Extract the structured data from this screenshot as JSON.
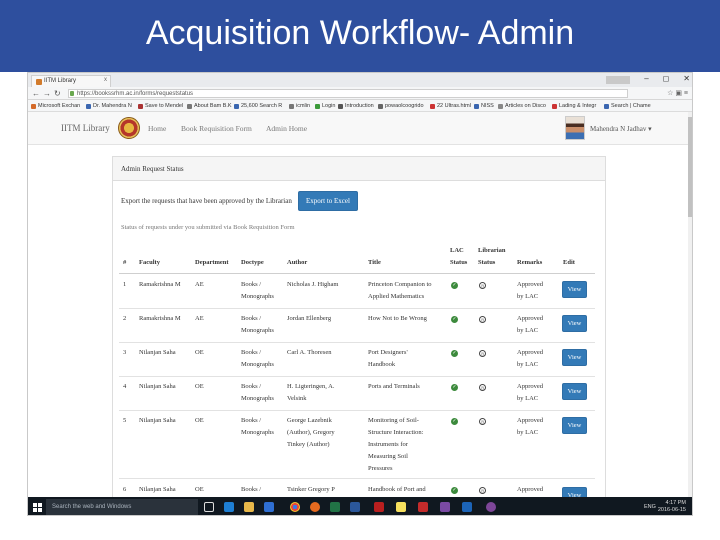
{
  "slide": {
    "title": "Acquisition Workflow- Admin"
  },
  "browser": {
    "tab_label": "IITM Library",
    "tab_close": "x",
    "url": "https://bookssrhm.ac.in/forms/requeststatus",
    "window_controls": [
      "–",
      "◻",
      "✕"
    ],
    "bookmarks": [
      {
        "label": "Microsoft Exchan",
        "color": "#d46a2a"
      },
      {
        "label": "Dr. Mahendra N",
        "color": "#3a66b0"
      },
      {
        "label": "Save to Mendel",
        "color": "#a33"
      },
      {
        "label": "About Bam B.K",
        "color": "#777"
      },
      {
        "label": "25,600 Search R",
        "color": "#3a66b0"
      },
      {
        "label": "icmlin",
        "color": "#777"
      },
      {
        "label": "Login",
        "color": "#3a9a3a"
      },
      {
        "label": "Introduction",
        "color": "#555"
      },
      {
        "label": "powaolcoogrido",
        "color": "#666"
      },
      {
        "label": "22 Ultras.html",
        "color": "#c33"
      },
      {
        "label": "NISS",
        "color": "#3a66b0"
      },
      {
        "label": "Articles on Disco",
        "color": "#888"
      },
      {
        "label": "Lading & Integr",
        "color": "#c33"
      },
      {
        "label": "Search | Chame",
        "color": "#3a66b0"
      }
    ]
  },
  "app_nav": {
    "brand": "IITM Library",
    "links": [
      "Home",
      "Book Requisition Form",
      "Admin Home"
    ],
    "user_name": "Mahendra N Jadhav ▾"
  },
  "panel": {
    "title": "Admin Request Status",
    "export_text": "Export the requests that have been approved by the Librarian",
    "export_button": "Export to Excel",
    "status_note": "Status of requests under you submitted via Book Requisition Form"
  },
  "table": {
    "headers": {
      "num": "#",
      "faculty": "Faculty",
      "department": "Department",
      "doctype": "Doctype",
      "author": "Author",
      "title": "Title",
      "lac_status_1": "LAC",
      "lac_status_2": "Status",
      "librarian_status_1": "Librarian",
      "librarian_status_2": "Status",
      "remarks": "Remarks",
      "edit": "Edit"
    },
    "rows": [
      {
        "num": "1",
        "faculty": "Ramakrishna M",
        "department": "AE",
        "doctype": [
          "Books /",
          "Monographs"
        ],
        "author": [
          "Nicholas J. Higham"
        ],
        "title": [
          "Princeton Companion to",
          "Applied Mathematics"
        ],
        "remarks": [
          "Approved",
          "by LAC"
        ],
        "view": "View"
      },
      {
        "num": "2",
        "faculty": "Ramakrishna M",
        "department": "AE",
        "doctype": [
          "Books /",
          "Monographs"
        ],
        "author": [
          "Jordan Ellenberg"
        ],
        "title": [
          "How Not to Be Wrong"
        ],
        "remarks": [
          "Approved",
          "by LAC"
        ],
        "view": "View"
      },
      {
        "num": "3",
        "faculty": "Nilanjan Saha",
        "department": "OE",
        "doctype": [
          "Books /",
          "Monographs"
        ],
        "author": [
          "Carl A. Thoresen"
        ],
        "title": [
          "Port Designers'",
          "Handbook"
        ],
        "remarks": [
          "Approved",
          "by LAC"
        ],
        "view": "View"
      },
      {
        "num": "4",
        "faculty": "Nilanjan Saha",
        "department": "OE",
        "doctype": [
          "Books /",
          "Monographs"
        ],
        "author": [
          "H. Ligteringen, A.",
          "Velsink"
        ],
        "title": [
          "Ports and Terminals"
        ],
        "remarks": [
          "Approved",
          "by LAC"
        ],
        "view": "View"
      },
      {
        "num": "5",
        "faculty": "Nilanjan Saha",
        "department": "OE",
        "doctype": [
          "Books /",
          "Monographs"
        ],
        "author": [
          "George Lazebnik",
          "(Author), Gregory",
          "Tinkey (Author)"
        ],
        "title": [
          "Monitoring of Soil-",
          "Structure Interaction:",
          "Instruments for",
          "Measuring Soil",
          "Pressures"
        ],
        "remarks": [
          "Approved",
          "by LAC"
        ],
        "view": "View"
      },
      {
        "num": "6",
        "faculty": "Nilanjan Saha",
        "department": "OE",
        "doctype": [
          "Books /"
        ],
        "author": [
          "Tsinker Gregory P"
        ],
        "title": [
          "Handbook of Port and"
        ],
        "remarks": [
          "Approved"
        ],
        "view": "View"
      }
    ]
  },
  "taskbar": {
    "search_placeholder": "Search the web and Windows",
    "language": "ENG",
    "time": "4:17 PM",
    "date": "2016-06-15",
    "icons": [
      "task-view",
      "edge",
      "file-explorer",
      "store",
      "chrome",
      "firefox",
      "excel",
      "word",
      "filezilla",
      "sticky-notes",
      "pdf",
      "winrar",
      "outlook",
      "tor"
    ]
  }
}
